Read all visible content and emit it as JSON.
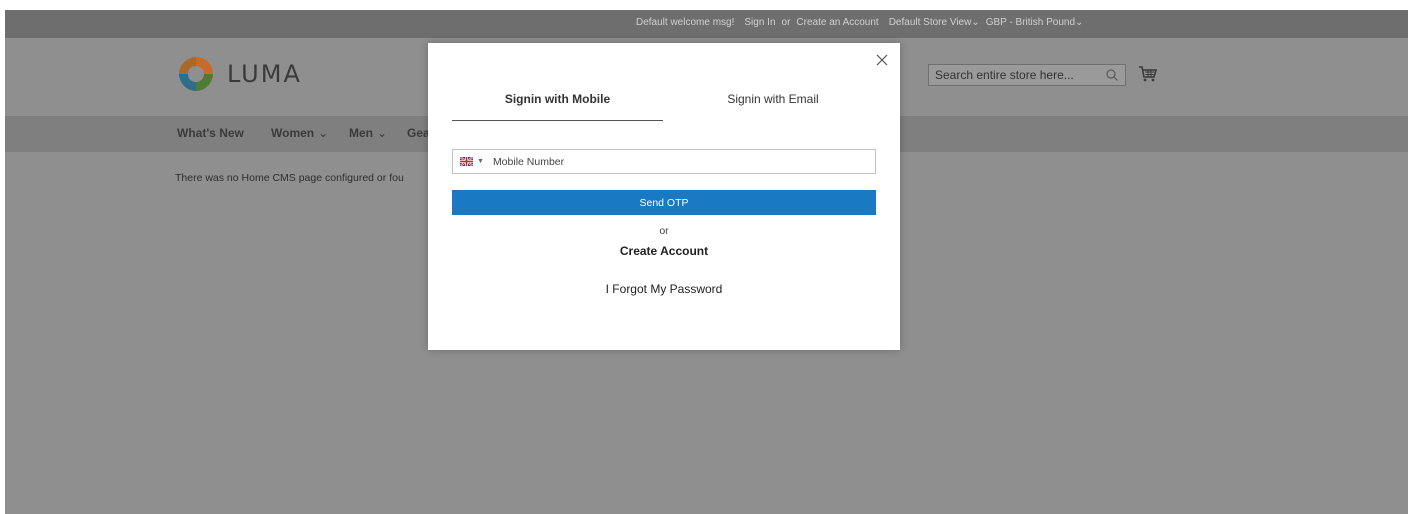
{
  "panel": {
    "welcome": "Default welcome msg!",
    "sign_in": "Sign In",
    "or": "or",
    "create_account": "Create an Account",
    "store_view": "Default Store View",
    "currency": "GBP - British Pound"
  },
  "header": {
    "logo_text": "LUMA",
    "search_placeholder": "Search entire store here...",
    "search_icon": "search-icon",
    "cart_icon": "cart-icon"
  },
  "nav": {
    "items": [
      {
        "label": "What's New",
        "has_dropdown": false
      },
      {
        "label": "Women",
        "has_dropdown": true
      },
      {
        "label": "Men",
        "has_dropdown": true
      },
      {
        "label": "Gea",
        "has_dropdown": false
      }
    ]
  },
  "content": {
    "notice": "There was no Home CMS page configured or fou"
  },
  "modal": {
    "tab_mobile": "Signin with Mobile",
    "tab_email": "Signin with Email",
    "active_tab": "Signin with Mobile",
    "country_flag": "gb-flag-icon",
    "mobile_placeholder": "Mobile Number",
    "send_otp": "Send OTP",
    "or": "or",
    "create_account": "Create Account",
    "forgot_password": "I Forgot My Password",
    "close_icon": "close-icon"
  },
  "colors": {
    "primary_button": "#1979c3",
    "overlay": "#8f8f8f",
    "panel_bar": "#6e6e6e"
  }
}
